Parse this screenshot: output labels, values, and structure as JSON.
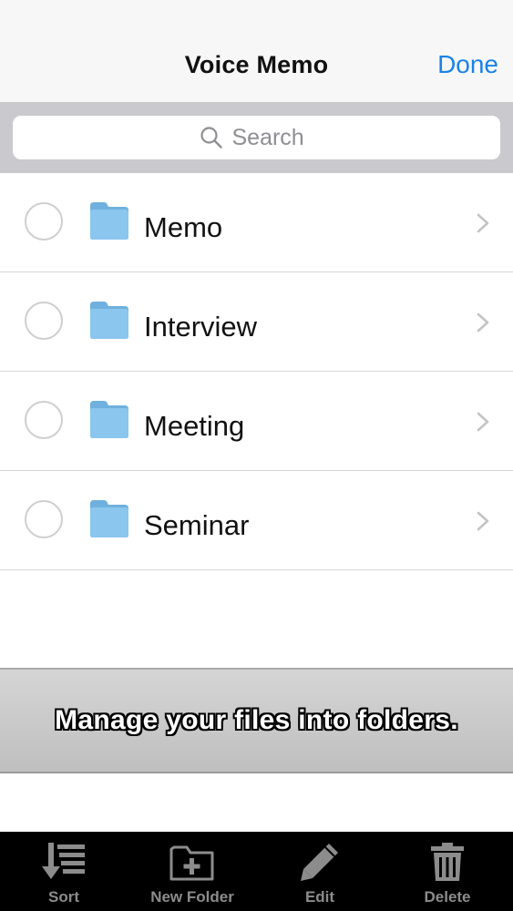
{
  "header": {
    "title": "Voice Memo",
    "done_label": "Done"
  },
  "search": {
    "placeholder": "Search",
    "value": ""
  },
  "folders": [
    {
      "name": "Memo"
    },
    {
      "name": "Interview"
    },
    {
      "name": "Meeting"
    },
    {
      "name": "Seminar"
    }
  ],
  "banner": {
    "text": "Manage your files into folders."
  },
  "toolbar": {
    "sort_label": "Sort",
    "new_folder_label": "New Folder",
    "edit_label": "Edit",
    "delete_label": "Delete"
  },
  "colors": {
    "accent": "#1a82e8",
    "folder": "#7fbde8",
    "toolbar_bg": "#000000",
    "toolbar_icon": "#8c8c8c"
  }
}
